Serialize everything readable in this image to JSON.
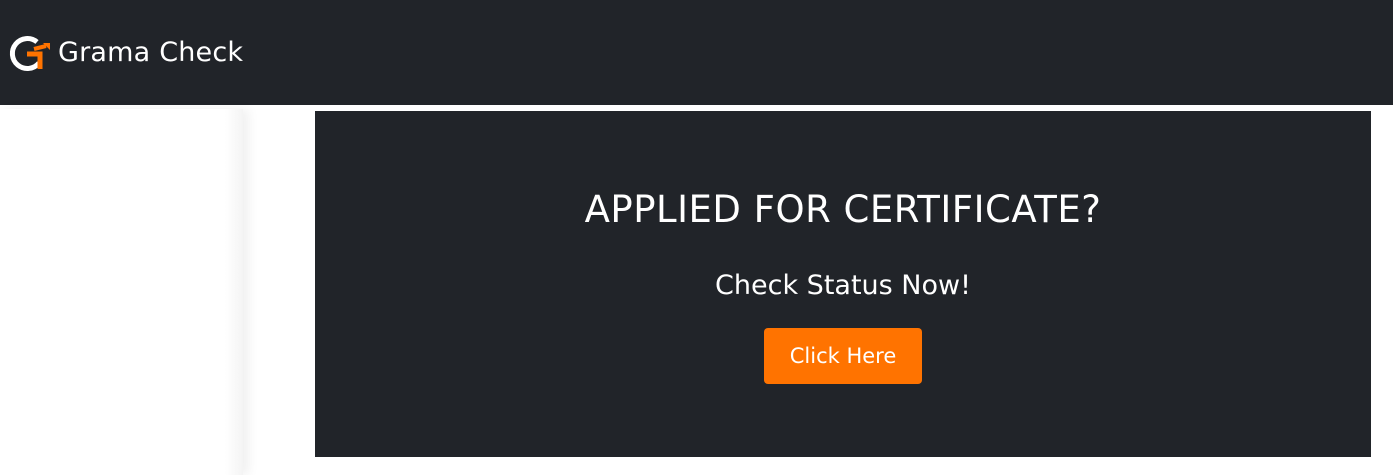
{
  "navbar": {
    "brand_name": "Grama Check",
    "logo_icon": "grama-check-logo-icon"
  },
  "hero": {
    "title": "APPLIED FOR CERTIFICATE?",
    "subtitle": "Check Status Now!",
    "button_label": "Click Here"
  },
  "colors": {
    "navbar_bg": "#212429",
    "hero_bg": "#212429",
    "accent": "#ff7300",
    "text": "#ffffff"
  }
}
